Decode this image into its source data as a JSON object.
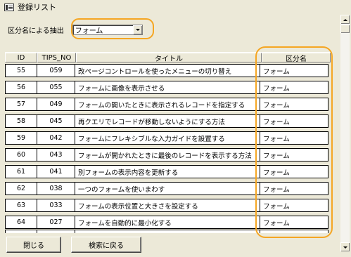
{
  "window": {
    "title": "登録リスト"
  },
  "filter": {
    "label": "区分名による抽出",
    "value": "フォーム"
  },
  "columns": {
    "id": "ID",
    "tips_no": "TIPS_NO",
    "title": "タイトル",
    "category": "区分名"
  },
  "rows": [
    {
      "id": "55",
      "tips_no": "059",
      "title": "改ページコントロールを使ったメニューの切り替え",
      "category": "フォーム"
    },
    {
      "id": "56",
      "tips_no": "055",
      "title": "フォームに画像を表示させる",
      "category": "フォーム"
    },
    {
      "id": "57",
      "tips_no": "049",
      "title": "フォームの開いたときに表示されるレコードを指定する",
      "category": "フォーム"
    },
    {
      "id": "58",
      "tips_no": "045",
      "title": "再クエリでレコードが移動しないようにする方法",
      "category": "フォーム"
    },
    {
      "id": "59",
      "tips_no": "042",
      "title": "フォームにフレキシブルな入力ガイドを設置する",
      "category": "フォーム"
    },
    {
      "id": "60",
      "tips_no": "043",
      "title": "フォームが開かれたときに最後のレコードを表示する方法",
      "category": "フォーム"
    },
    {
      "id": "61",
      "tips_no": "041",
      "title": "別フォームの表示内容を更新する",
      "category": "フォーム"
    },
    {
      "id": "62",
      "tips_no": "038",
      "title": "一つのフォームを使いまわす",
      "category": "フォーム"
    },
    {
      "id": "63",
      "tips_no": "033",
      "title": "フォームの表示位置と大きさを設定する",
      "category": "フォーム"
    },
    {
      "id": "64",
      "tips_no": "027",
      "title": "フォームを自動的に最小化する",
      "category": "フォーム"
    }
  ],
  "buttons": {
    "close": "閉じる",
    "search": "検索に戻る"
  },
  "icons": {
    "title": "form-window-icon"
  },
  "colors": {
    "highlight_oval": "#f5a623",
    "window_bg": "#ece9d8"
  }
}
